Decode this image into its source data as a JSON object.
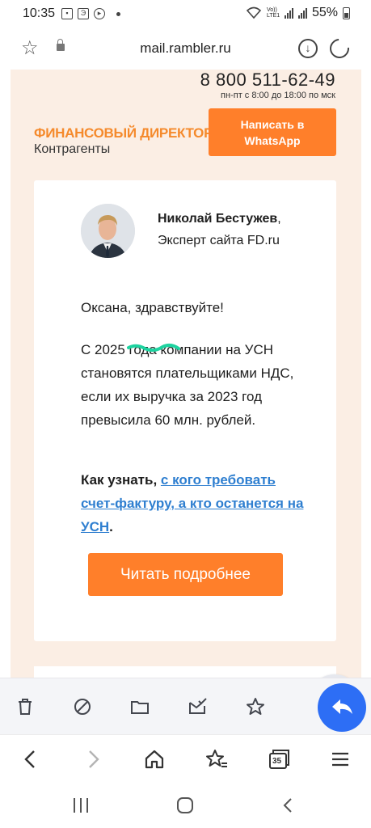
{
  "status_bar": {
    "time": "10:35",
    "battery": "55%",
    "network": "Vo)) LTE1"
  },
  "url_bar": {
    "url": "mail.rambler.ru"
  },
  "email": {
    "phone": "8 800 511-62-49",
    "hours": "пн-пт с 8:00 до 18:00 по мск",
    "brand_main": "ФИНАНСОВЫЙ ДИРЕКТОР",
    "brand_sub": "Контрагенты",
    "whatsapp_line1": "Написать в",
    "whatsapp_line2": "WhatsApp",
    "expert_name": "Николай Бестужев",
    "expert_name_comma": ",",
    "expert_title": "Эксперт сайта FD.ru",
    "greeting": "Оксана, здравствуйте!",
    "body": "С 2025 года компании на УСН становятся плательщиками НДС, если их выручка за 2023 год превысила 60 млн. рублей.",
    "cta_prefix": "Как узнать, ",
    "cta_link": "с кого требовать счет-фактуру, а кто останется на УСН",
    "cta_suffix": ".",
    "read_more": "Читать подробнее"
  },
  "browser_nav": {
    "tab_count": "35"
  },
  "colors": {
    "accent_orange": "#ff7f2a",
    "link_blue": "#2f7fd0",
    "email_background": "#fbeee4",
    "reply_fab": "#2d6ef5",
    "highlight_teal": "#1ed3a0"
  },
  "icons": {
    "toolbar": [
      "trash-icon",
      "spam-icon",
      "folder-icon",
      "mark-read-icon",
      "star-icon"
    ],
    "nav": [
      "back-icon",
      "forward-icon",
      "home-icon",
      "bookmarks-icon",
      "tabs-icon",
      "menu-icon"
    ],
    "android": [
      "recents-icon",
      "home-circle-icon",
      "back-chevron-icon"
    ]
  }
}
